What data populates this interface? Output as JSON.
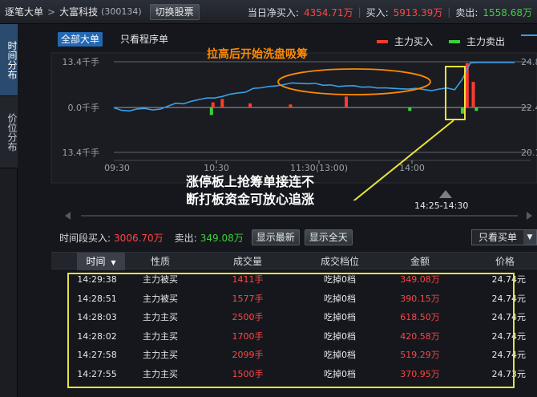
{
  "header": {
    "breadcrumb": "逐笔大单",
    "separator": ">",
    "stock_name": "大富科技",
    "stock_code": "(300134)",
    "switch_label": "切换股票",
    "net_buy_label": "当日净买入:",
    "net_buy_value": "4354.71万",
    "buy_label": "买入:",
    "buy_value": "5913.39万",
    "sell_label": "卖出:",
    "sell_value": "1558.68万"
  },
  "sidebar": {
    "tabs": [
      {
        "label": "时间分布",
        "active": true
      },
      {
        "label": "价位分布",
        "active": false
      }
    ]
  },
  "chart_controls": {
    "all_orders_label": "全部大单",
    "program_only_label": "只看程序单"
  },
  "legend": [
    {
      "label": "主力买入",
      "color": "#ff3b30"
    },
    {
      "label": "主力卖出",
      "color": "#3bd13b"
    },
    {
      "label": "",
      "color": "#3a9ee8"
    }
  ],
  "chart_data": {
    "type": "line",
    "left_axis_ticks": [
      "13.4千手",
      "0.0千手",
      "13.4千手"
    ],
    "right_axis_ticks": [
      "24.8",
      "22.4",
      "20.1"
    ],
    "x_tick_labels": [
      "09:30",
      "10:30",
      "11:30(13:00)",
      "14:00"
    ],
    "left_ylim": [
      -13.4,
      13.4
    ],
    "right_ylim": [
      20.1,
      24.8
    ],
    "grid": true,
    "series": [
      {
        "name": "",
        "color": "#3a9ee8",
        "x_minutes": [
          0,
          5,
          10,
          15,
          20,
          25,
          30,
          35,
          40,
          45,
          50,
          55,
          60,
          65,
          70,
          75,
          80,
          85,
          90,
          95,
          100,
          105,
          110,
          115,
          120,
          125,
          130,
          135,
          140,
          145,
          150,
          155,
          160,
          165,
          170,
          175,
          180,
          185,
          190,
          195,
          200,
          205,
          210,
          215,
          220,
          225,
          230,
          235,
          240
        ],
        "price": [
          22.42,
          22.28,
          22.25,
          22.35,
          22.38,
          22.3,
          22.34,
          22.5,
          22.65,
          22.62,
          22.75,
          22.84,
          22.92,
          22.92,
          23.0,
          23.12,
          23.18,
          23.22,
          23.42,
          23.45,
          23.52,
          23.55,
          23.62,
          23.7,
          23.68,
          23.66,
          23.68,
          23.58,
          23.6,
          23.52,
          23.55,
          23.56,
          23.48,
          23.5,
          23.44,
          23.45,
          23.42,
          23.4,
          23.38,
          23.42,
          23.36,
          23.3,
          23.38,
          23.44,
          23.35,
          23.9,
          24.74,
          24.76,
          24.76
        ]
      }
    ],
    "bars": {
      "buy": [
        {
          "x_minutes": 64,
          "value": 1.5
        },
        {
          "x_minutes": 70,
          "value": 2.5
        },
        {
          "x_minutes": 88,
          "value": 1.2
        },
        {
          "x_minutes": 114,
          "value": 0.9
        },
        {
          "x_minutes": 150,
          "value": 3.2
        },
        {
          "x_minutes": 228,
          "value": 13.0
        },
        {
          "x_minutes": 232,
          "value": 7.5
        }
      ],
      "sell": [
        {
          "x_minutes": 63,
          "value": -2.2
        },
        {
          "x_minutes": 191,
          "value": -1.0
        },
        {
          "x_minutes": 225,
          "value": -1.8
        },
        {
          "x_minutes": 234,
          "value": -1.0
        }
      ]
    }
  },
  "annotations": {
    "top": "拉高后开始洗盘吸筹",
    "middle_line1": "涨停板上抢筹单接连不",
    "middle_line2": "断打板资金可放心追涨"
  },
  "scroll": {
    "range_label": "14:25-14:30"
  },
  "period": {
    "buy_label": "时间段买入:",
    "buy_value": "3006.70万",
    "sell_label": "卖出:",
    "sell_value": "349.08万",
    "show_latest_label": "显示最新",
    "show_all_day_label": "显示全天",
    "filter_value": "只看买单"
  },
  "table": {
    "columns": [
      "时间",
      "性质",
      "成交量",
      "成交档位",
      "金额",
      "价格"
    ],
    "sort_arrow": "▼",
    "rows": [
      {
        "time": "14:29:38",
        "type": "主力被买",
        "volume": "1411手",
        "level": "吃掉0档",
        "amount": "349.08万",
        "price": "24.74元"
      },
      {
        "time": "14:28:51",
        "type": "主力被买",
        "volume": "1577手",
        "level": "吃掉0档",
        "amount": "390.15万",
        "price": "24.74元"
      },
      {
        "time": "14:28:03",
        "type": "主力主买",
        "volume": "2500手",
        "level": "吃掉0档",
        "amount": "618.50万",
        "price": "24.74元"
      },
      {
        "time": "14:28:02",
        "type": "主力主买",
        "volume": "1700手",
        "level": "吃掉0档",
        "amount": "420.58万",
        "price": "24.74元"
      },
      {
        "time": "14:27:58",
        "type": "主力主买",
        "volume": "2099手",
        "level": "吃掉0档",
        "amount": "519.29万",
        "price": "24.74元"
      },
      {
        "time": "14:27:55",
        "type": "主力主买",
        "volume": "1500手",
        "level": "吃掉0档",
        "amount": "370.95万",
        "price": "24.73元"
      }
    ]
  }
}
